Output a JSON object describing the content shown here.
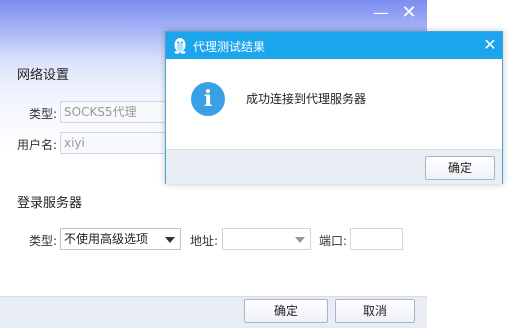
{
  "settings": {
    "network_title": "网络设置",
    "proxy_type_label": "类型:",
    "proxy_type_value": "SOCKS5代理",
    "username_label": "用户名:",
    "username_value": "xiyi",
    "login_title": "登录服务器",
    "login_type_label": "类型:",
    "login_type_value": "不使用高级选项",
    "address_label": "地址:",
    "address_value": "",
    "port_label": "端口:",
    "port_value": "",
    "ok_label": "确定",
    "cancel_label": "取消",
    "minimize_glyph": "—",
    "close_glyph": "✕"
  },
  "dialog": {
    "title": "代理测试结果",
    "message": "成功连接到代理服务器",
    "ok_label": "确定",
    "close_glyph": "✕",
    "info_glyph": "i"
  },
  "colors": {
    "dialog_titlebar": "#1aa5ed",
    "info_icon": "#3aa0e6",
    "header_gradient_top": "#7d8cf2"
  },
  "icons": {
    "dialog_app_icon": "qq-penguin-icon",
    "dialog_status_icon": "info-icon"
  }
}
